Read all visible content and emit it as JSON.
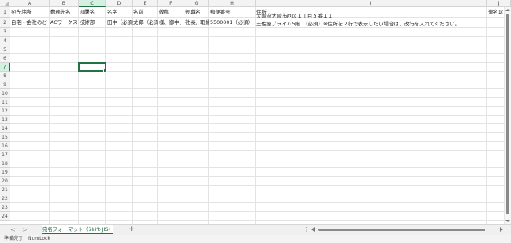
{
  "columns": [
    "A",
    "B",
    "C",
    "D",
    "E",
    "F",
    "G",
    "H",
    "I",
    "J"
  ],
  "rows": [
    "1",
    "2",
    "3",
    "4",
    "5",
    "6",
    "7",
    "8",
    "9",
    "10",
    "11",
    "12",
    "13",
    "14",
    "15",
    "16",
    "17",
    "18",
    "19",
    "20",
    "21",
    "22",
    "23",
    "24"
  ],
  "headers": {
    "A": "宛先住所",
    "B": "勤務先名",
    "C": "部署名",
    "D": "名字",
    "E": "名前",
    "F": "敬称",
    "G": "役職名",
    "H": "郵便番号",
    "I": "住所",
    "J": "連名1("
  },
  "row2": {
    "A": "自宅・会社のど",
    "B": "ACワークス",
    "C": "技術部",
    "D": "田中（必須",
    "E": "太郎（必須",
    "F": "様、御中、",
    "G": "社長、取締",
    "H": "5500001（必須）"
  },
  "address": {
    "line1": "大阪府大阪市西区１丁目５番１１",
    "line2": "土佐屋プライム5階　（必須）※住所を２行で表示したい場合は、改行を入れてください。"
  },
  "selected": {
    "column": "C",
    "row": "7"
  },
  "sheet_tab": "宛名フォーマット（Shift-JIS）",
  "nav": {
    "prev": "<",
    "next": ">"
  },
  "add_sheet": "+",
  "status": {
    "ready": "準備完了",
    "numlock": "NumLock"
  },
  "colors": {
    "accent": "#217346",
    "header_bg": "#f3f3f3",
    "grid": "#e3e3e3"
  },
  "icons": [
    "add-sheet-icon",
    "scroll-arrow-icon",
    "fill-handle-icon"
  ]
}
